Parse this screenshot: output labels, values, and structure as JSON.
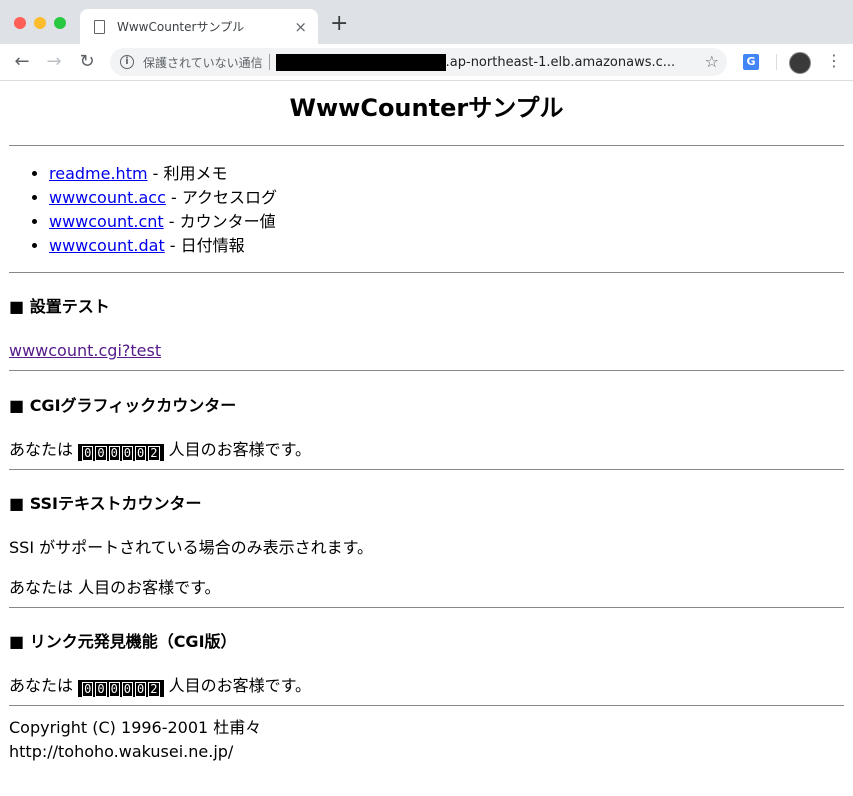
{
  "browser": {
    "tab_title": "WwwCounterサンプル",
    "tab_close": "×",
    "new_tab": "+",
    "security_label": "保護されていない通信",
    "url_visible": ".ap-northeast-1.elb.amazonaws.c...",
    "translate_icon_label": "G"
  },
  "page": {
    "title": "WwwCounterサンプル",
    "files": [
      {
        "link": "readme.htm",
        "desc": " - 利用メモ"
      },
      {
        "link": "wwwcount.acc",
        "desc": " - アクセスログ"
      },
      {
        "link": "wwwcount.cnt",
        "desc": " - カウンター値"
      },
      {
        "link": "wwwcount.dat",
        "desc": " - 日付情報"
      }
    ],
    "setup_test": {
      "heading": "■ 設置テスト",
      "link": "wwwcount.cgi?test"
    },
    "cgi_counter": {
      "heading": "■ CGIグラフィックカウンター",
      "before": "あなたは ",
      "digits": [
        "0",
        "0",
        "0",
        "0",
        "0",
        "2"
      ],
      "after": " 人目のお客様です。"
    },
    "ssi_counter": {
      "heading": "■ SSIテキストカウンター",
      "note": "SSI がサポートされている場合のみ表示されます。",
      "line": "あなたは 人目のお客様です。"
    },
    "referer": {
      "heading": "■ リンク元発見機能（CGI版）",
      "before": "あなたは ",
      "digits": [
        "0",
        "0",
        "0",
        "0",
        "0",
        "2"
      ],
      "after": " 人目のお客様です。"
    },
    "footer": {
      "copyright": "Copyright (C) 1996-2001 杜甫々",
      "site": "http://tohoho.wakusei.ne.jp/"
    }
  },
  "colors": {
    "traffic_red": "#ff5f57",
    "traffic_yellow": "#febc2e",
    "traffic_green": "#28c840",
    "link": "#0000ee",
    "visited_link": "#551a8b"
  }
}
